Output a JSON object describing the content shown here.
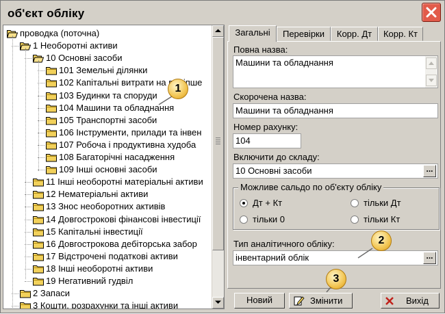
{
  "window": {
    "title": "об'єкт обліку"
  },
  "tree": {
    "items": [
      {
        "label": "проводка (поточна)",
        "level": 0,
        "open": true
      },
      {
        "label": "1 Необоротні активи",
        "level": 1,
        "open": true
      },
      {
        "label": "10 Основні засоби",
        "level": 2,
        "open": true
      },
      {
        "label": "101 Земельні ділянки",
        "level": 3,
        "open": false
      },
      {
        "label": "102 Капітальні витрати на поліпше",
        "level": 3,
        "open": false
      },
      {
        "label": "103 Будинки та споруди",
        "level": 3,
        "open": false
      },
      {
        "label": "104 Машини та обладнання",
        "level": 3,
        "open": false,
        "selected": true
      },
      {
        "label": "105 Транспортні засоби",
        "level": 3,
        "open": false
      },
      {
        "label": "106 Інструменти, прилади та інвен",
        "level": 3,
        "open": false
      },
      {
        "label": "107 Робоча і продуктивна худоба",
        "level": 3,
        "open": false
      },
      {
        "label": "108 Багаторічні насадження",
        "level": 3,
        "open": false
      },
      {
        "label": "109 Інші основні засоби",
        "level": 3,
        "open": false
      },
      {
        "label": "11 Інші необоротні матеріальні активи",
        "level": 2,
        "open": false
      },
      {
        "label": "12 Нематеріальні активи",
        "level": 2,
        "open": false
      },
      {
        "label": "13 Знос необоротних активів",
        "level": 2,
        "open": false
      },
      {
        "label": "14 Довгострокові фінансові інвестиції",
        "level": 2,
        "open": false
      },
      {
        "label": "15 Капітальні інвестиції",
        "level": 2,
        "open": false
      },
      {
        "label": "16 Довгострокова дебіторська забор",
        "level": 2,
        "open": false
      },
      {
        "label": "17 Відстрочені податкові активи",
        "level": 2,
        "open": false
      },
      {
        "label": "18 Інші необоротні активи",
        "level": 2,
        "open": false
      },
      {
        "label": "19 Негативний гудвіл",
        "level": 2,
        "open": false
      },
      {
        "label": "2 Запаси",
        "level": 1,
        "open": false
      },
      {
        "label": "3 Кошти, розрахунки та інші активи",
        "level": 1,
        "open": false
      }
    ]
  },
  "tabs": [
    {
      "label": "Загальні",
      "active": true
    },
    {
      "label": "Перевірки",
      "active": false
    },
    {
      "label": "Корр. Дт",
      "active": false
    },
    {
      "label": "Корр. Кт",
      "active": false
    }
  ],
  "form": {
    "full_name_label": "Повна назва:",
    "full_name_value": "Машини та обладнання",
    "short_name_label": "Скорочена назва:",
    "short_name_value": "Машини та обладнання",
    "account_number_label": "Номер рахунку:",
    "account_number_value": "104",
    "include_in_label": "Включити до складу:",
    "include_in_value": "10 Основні засоби",
    "balance_group_title": "Можливе сальдо по об'єкту обліку",
    "balance_options": [
      {
        "label": "Дт + Кт",
        "checked": true
      },
      {
        "label": "тільки Дт",
        "checked": false
      },
      {
        "label": "тільки 0",
        "checked": false
      },
      {
        "label": "тільки Кт",
        "checked": false
      }
    ],
    "analytic_type_label": "Тип аналітичного обліку:",
    "analytic_type_value": "інвентарний облік",
    "ellipsis": "..."
  },
  "buttons": {
    "new_label": "Новий",
    "edit_label": "Змінити",
    "exit_label": "Вихід"
  },
  "callouts": [
    "1",
    "2",
    "3"
  ],
  "colors": {
    "folder": "#f2d15b",
    "close": "#e25b4a",
    "callout": "#f2c552"
  }
}
